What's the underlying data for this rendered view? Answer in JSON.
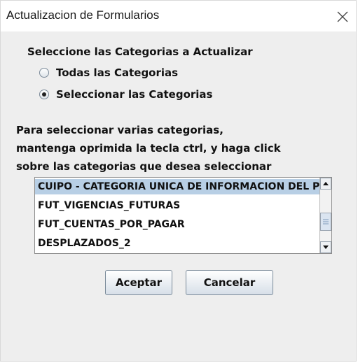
{
  "window": {
    "title": "Actualizacion de Formularios",
    "close_symbol": "✕"
  },
  "prompt": "Seleccione las Categorias a Actualizar",
  "options": [
    {
      "label": "Todas las Categorias",
      "checked": false
    },
    {
      "label": "Seleccionar las Categorias",
      "checked": true
    }
  ],
  "instructions": [
    "Para seleccionar varias categorias,",
    "mantenga oprimida la tecla ctrl, y haga click",
    "sobre las categorias que desea seleccionar"
  ],
  "categories": [
    {
      "label": "CUIPO - CATEGORIA UNICA DE INFORMACION DEL PRESUPUESTO ORDINARIO",
      "selected": true
    },
    {
      "label": "FUT_VIGENCIAS_FUTURAS",
      "selected": false
    },
    {
      "label": "FUT_CUENTAS_POR_PAGAR",
      "selected": false
    },
    {
      "label": "DESPLAZADOS_2",
      "selected": false
    }
  ],
  "buttons": {
    "accept": "Aceptar",
    "cancel": "Cancelar"
  },
  "colors": {
    "dialog_bg": "#eeeeee",
    "selection": "#b8cfe5",
    "titlebar": "#ffffff"
  }
}
